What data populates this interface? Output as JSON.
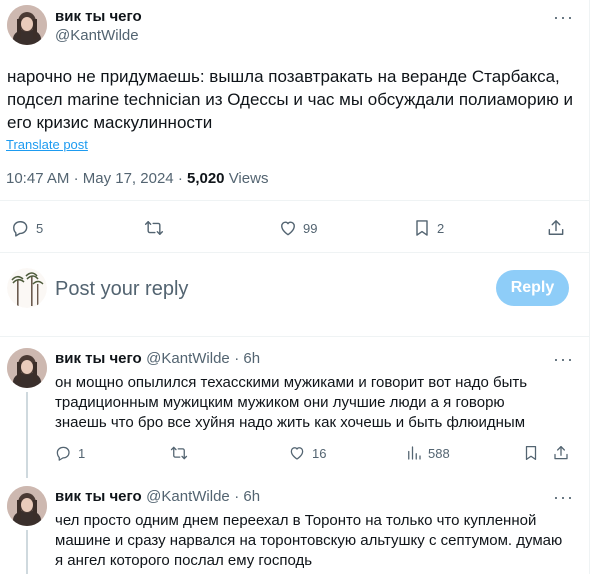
{
  "main_tweet": {
    "author_name": "вик ты чего",
    "author_handle": "@KantWilde",
    "text_lines": [
      "нарочно не придумаешь: вышла позавтракать на веранде Старбакса,",
      "подсел marine technician из Одессы и час мы обсуждали полиаморию и",
      "его кризис маскулинности"
    ],
    "translate_label": "Translate post",
    "time": "10:47 AM",
    "dot": "·",
    "date": "May 17, 2024",
    "views_count": "5,020",
    "views_label": "Views",
    "actions": {
      "replies": "5",
      "retweets": "",
      "likes": "99",
      "bookmarks": "2"
    }
  },
  "composer": {
    "placeholder": "Post your reply",
    "button_label": "Reply"
  },
  "replies": [
    {
      "author_name": "вик ты чего",
      "author_handle": "@KantWilde",
      "age": "· 6h",
      "text_lines": [
        "он мощно опылился техасскими мужиками и говорит вот надо быть",
        "традиционным мужицким мужиком они лучшие люди а я говорю",
        "знаешь что бро все хуйня надо жить как хочешь и быть флюидным"
      ],
      "actions": {
        "replies": "1",
        "retweets": "",
        "likes": "16",
        "views": "588"
      }
    },
    {
      "author_name": "вик ты чего",
      "author_handle": "@KantWilde",
      "age": "· 6h",
      "text_lines": [
        "чел просто одним днем переехал в Торонто на только что купленной",
        "машине и сразу нарвался на торонтовскую альтушку с септумом. думаю",
        "я ангел которого послал ему господь"
      ]
    }
  ],
  "icons": {
    "more": "more-horizontal-icon",
    "reply": "speech-bubble-icon",
    "retweet": "retweet-arrows-icon",
    "like": "heart-icon",
    "bookmark": "bookmark-icon",
    "share": "share-upload-icon",
    "views": "bar-chart-icon"
  },
  "colors": {
    "accent": "#1d9bf0",
    "reply_button_disabled": "#8ecdf8",
    "secondary_text": "#536471",
    "divider": "#eff3f4"
  }
}
